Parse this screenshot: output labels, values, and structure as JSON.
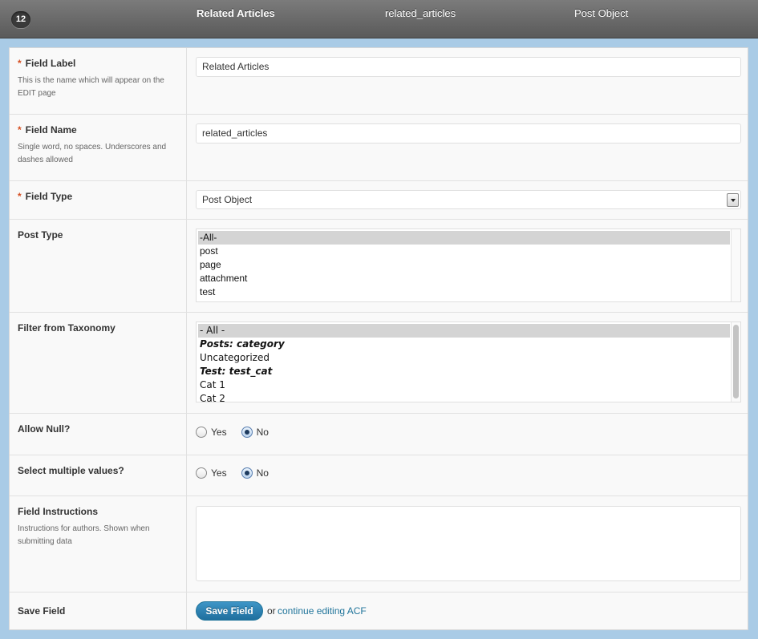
{
  "header": {
    "order_number": "12",
    "field_label": "Related Articles",
    "field_name": "related_articles",
    "field_type": "Post Object"
  },
  "required_marker": "*",
  "field_label": {
    "title": "Field Label",
    "description": "This is the name which will appear on the EDIT page",
    "value": "Related Articles"
  },
  "field_name": {
    "title": "Field Name",
    "description": "Single word, no spaces. Underscores and dashes allowed",
    "value": "related_articles"
  },
  "field_type": {
    "title": "Field Type",
    "value": "Post Object"
  },
  "post_type": {
    "title": "Post Type",
    "options": [
      "-All-",
      "post",
      "page",
      "attachment",
      "test"
    ],
    "selected": "-All-"
  },
  "taxonomy": {
    "title": "Filter from Taxonomy",
    "options": [
      {
        "label": "- All -",
        "selected": true,
        "group": false
      },
      {
        "label": "Posts: category",
        "selected": false,
        "group": true
      },
      {
        "label": "Uncategorized",
        "selected": false,
        "group": false
      },
      {
        "label": "Test: test_cat",
        "selected": false,
        "group": true
      },
      {
        "label": "Cat 1",
        "selected": false,
        "group": false
      },
      {
        "label": "Cat 2",
        "selected": false,
        "group": false
      }
    ]
  },
  "allow_null": {
    "title": "Allow Null?",
    "yes_label": "Yes",
    "no_label": "No",
    "selected": "No"
  },
  "multiple": {
    "title": "Select multiple values?",
    "yes_label": "Yes",
    "no_label": "No",
    "selected": "No"
  },
  "instructions": {
    "title": "Field Instructions",
    "description": "Instructions for authors. Shown when submitting data",
    "value": ""
  },
  "save": {
    "title": "Save Field",
    "button_label": "Save Field",
    "or_text": "or",
    "link_text": "continue editing ACF"
  },
  "colors": {
    "accent": "#21759b",
    "required": "#d54e21",
    "header_bg": "#6a6a6a",
    "page_bg": "#a9cbe6"
  }
}
